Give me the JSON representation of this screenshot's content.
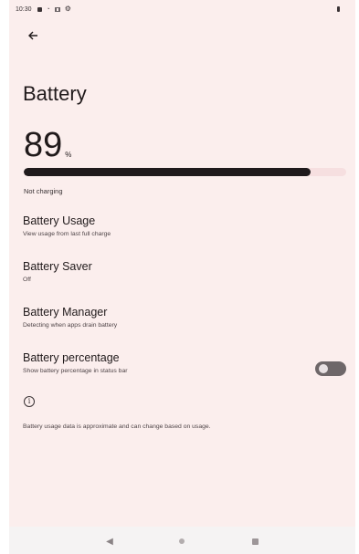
{
  "status_bar": {
    "time": "10:30",
    "icons": [
      "notification-square-icon",
      "wifi-icon",
      "grid-icon",
      "settings-gear-icon"
    ],
    "battery_icon": "battery-icon"
  },
  "header": {
    "back_icon": "back-arrow-icon",
    "title": "Battery"
  },
  "battery": {
    "level": "89",
    "unit": "%",
    "level_fraction": 0.89,
    "charging_status": "Not charging"
  },
  "preferences": [
    {
      "title": "Battery Usage",
      "summary": "View usage from last full charge"
    },
    {
      "title": "Battery Saver",
      "summary": "Off"
    },
    {
      "title": "Battery Manager",
      "summary": "Detecting when apps drain battery"
    },
    {
      "title": "Battery percentage",
      "summary": "Show battery percentage in status bar",
      "toggle": false
    }
  ],
  "footer": {
    "info_icon": "info-icon",
    "text": "Battery usage data is approximate and can change based on usage."
  },
  "nav_bar": {
    "back": "nav-back-icon",
    "home": "nav-home-icon",
    "recents": "nav-recents-icon"
  },
  "colors": {
    "background": "#fbeeed",
    "bar_fill": "#1f1a1c",
    "bar_track": "#f6dfe0",
    "toggle_off": "#6e6769"
  }
}
